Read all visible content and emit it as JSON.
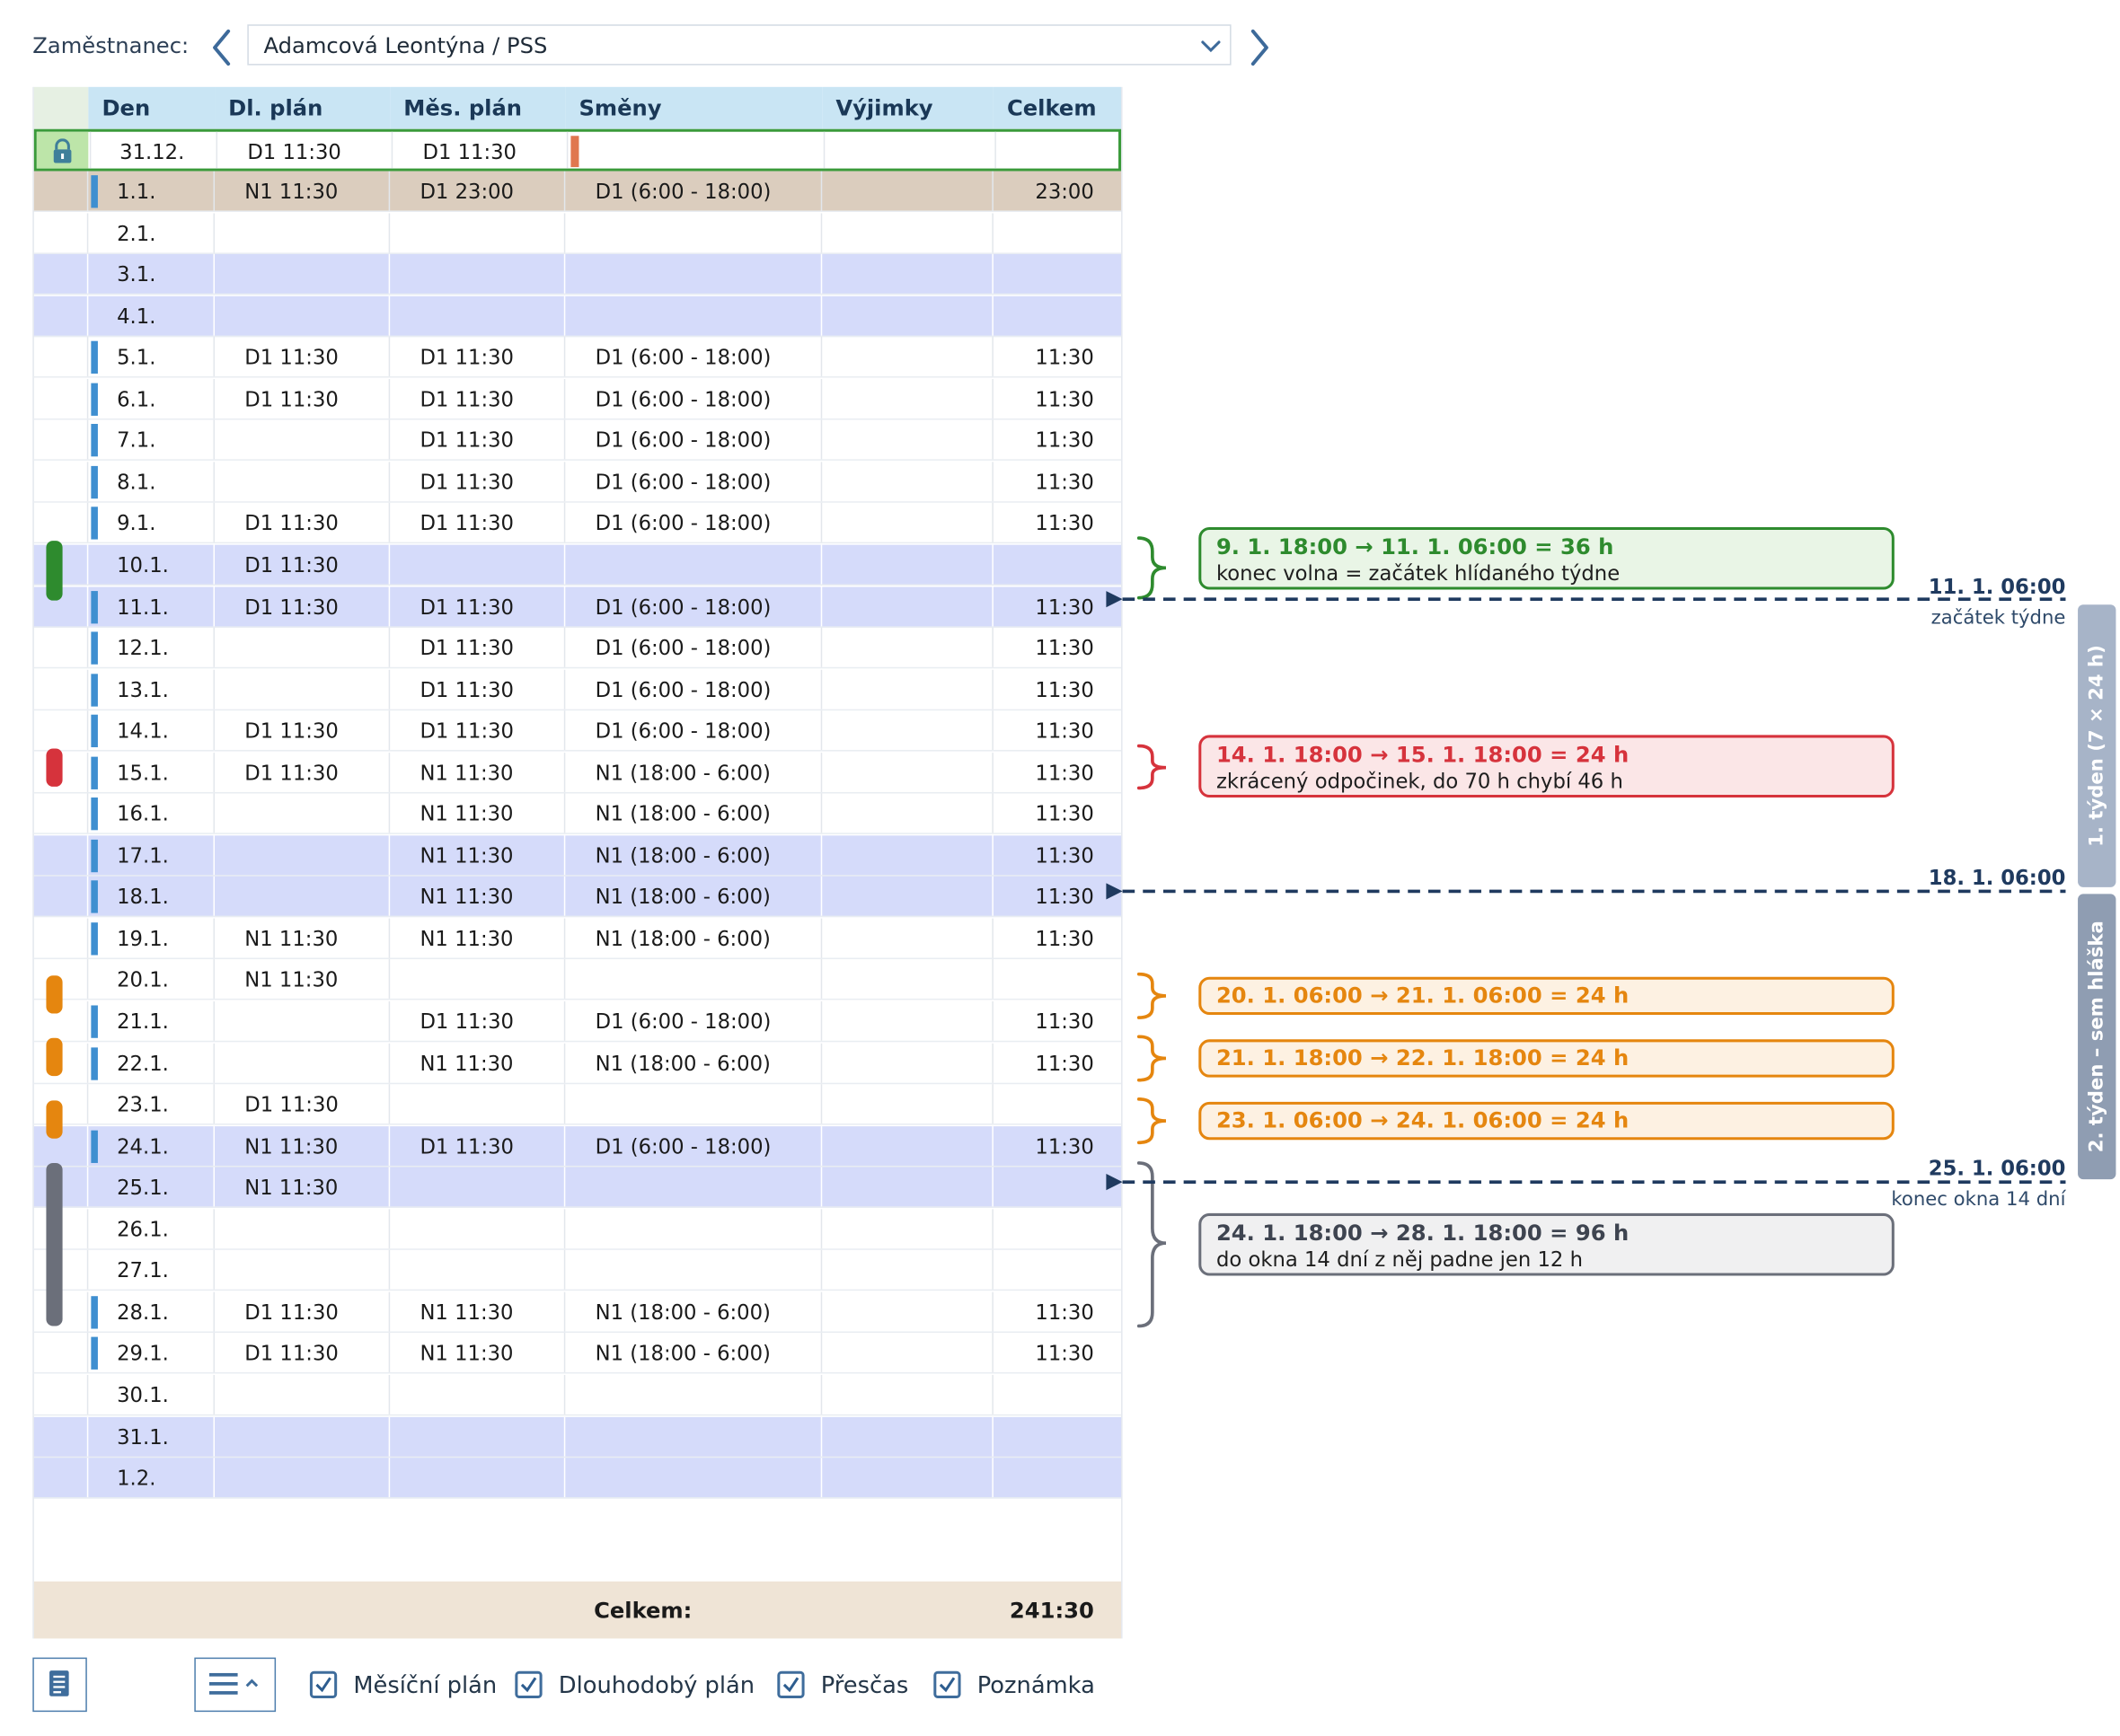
{
  "employee": {
    "label": "Zaměstnanec:",
    "value": "Adamcová Leontýna / PSS"
  },
  "columns": [
    "",
    "Den",
    "Dl. plán",
    "Měs. plán",
    "Směny",
    "Výjimky",
    "Celkem"
  ],
  "rows": [
    {
      "day": "31.12.",
      "dl": "D1 11:30",
      "mes": "D1 11:30",
      "smeny": "",
      "vyjimky": "",
      "celkem": "",
      "locked": true
    },
    {
      "day": "1.1.",
      "dl": "N1 11:30",
      "mes": "D1 23:00",
      "smeny": "D1 (6:00 - 18:00)",
      "vyjimky": "",
      "celkem": "23:00",
      "selected": true,
      "bar": true
    },
    {
      "day": "2.1.",
      "dl": "",
      "mes": "",
      "smeny": "",
      "vyjimky": "",
      "celkem": ""
    },
    {
      "day": "3.1.",
      "dl": "",
      "mes": "",
      "smeny": "",
      "vyjimky": "",
      "celkem": "",
      "weekend": true
    },
    {
      "day": "4.1.",
      "dl": "",
      "mes": "",
      "smeny": "",
      "vyjimky": "",
      "celkem": "",
      "weekend": true
    },
    {
      "day": "5.1.",
      "dl": "D1 11:30",
      "mes": "D1 11:30",
      "smeny": "D1 (6:00 - 18:00)",
      "vyjimky": "",
      "celkem": "11:30",
      "bar": true
    },
    {
      "day": "6.1.",
      "dl": "D1 11:30",
      "mes": "D1 11:30",
      "smeny": "D1 (6:00 - 18:00)",
      "vyjimky": "",
      "celkem": "11:30",
      "bar": true
    },
    {
      "day": "7.1.",
      "dl": "",
      "mes": "D1 11:30",
      "smeny": "D1 (6:00 - 18:00)",
      "vyjimky": "",
      "celkem": "11:30",
      "bar": true
    },
    {
      "day": "8.1.",
      "dl": "",
      "mes": "D1 11:30",
      "smeny": "D1 (6:00 - 18:00)",
      "vyjimky": "",
      "celkem": "11:30",
      "bar": true
    },
    {
      "day": "9.1.",
      "dl": "D1 11:30",
      "mes": "D1 11:30",
      "smeny": "D1 (6:00 - 18:00)",
      "vyjimky": "",
      "celkem": "11:30",
      "bar": true
    },
    {
      "day": "10.1.",
      "dl": "D1 11:30",
      "mes": "",
      "smeny": "",
      "vyjimky": "",
      "celkem": "",
      "weekend": true
    },
    {
      "day": "11.1.",
      "dl": "D1 11:30",
      "mes": "D1 11:30",
      "smeny": "D1 (6:00 - 18:00)",
      "vyjimky": "",
      "celkem": "11:30",
      "weekend": true,
      "bar": true
    },
    {
      "day": "12.1.",
      "dl": "",
      "mes": "D1 11:30",
      "smeny": "D1 (6:00 - 18:00)",
      "vyjimky": "",
      "celkem": "11:30",
      "bar": true
    },
    {
      "day": "13.1.",
      "dl": "",
      "mes": "D1 11:30",
      "smeny": "D1 (6:00 - 18:00)",
      "vyjimky": "",
      "celkem": "11:30",
      "bar": true
    },
    {
      "day": "14.1.",
      "dl": "D1 11:30",
      "mes": "D1 11:30",
      "smeny": "D1 (6:00 - 18:00)",
      "vyjimky": "",
      "celkem": "11:30",
      "bar": true
    },
    {
      "day": "15.1.",
      "dl": "D1 11:30",
      "mes": "N1 11:30",
      "smeny": "N1 (18:00 - 6:00)",
      "vyjimky": "",
      "celkem": "11:30",
      "bar": true
    },
    {
      "day": "16.1.",
      "dl": "",
      "mes": "N1 11:30",
      "smeny": "N1 (18:00 - 6:00)",
      "vyjimky": "",
      "celkem": "11:30",
      "bar": true
    },
    {
      "day": "17.1.",
      "dl": "",
      "mes": "N1 11:30",
      "smeny": "N1 (18:00 - 6:00)",
      "vyjimky": "",
      "celkem": "11:30",
      "weekend": true,
      "bar": true
    },
    {
      "day": "18.1.",
      "dl": "",
      "mes": "N1 11:30",
      "smeny": "N1 (18:00 - 6:00)",
      "vyjimky": "",
      "celkem": "11:30",
      "weekend": true,
      "bar": true
    },
    {
      "day": "19.1.",
      "dl": "N1 11:30",
      "mes": "N1 11:30",
      "smeny": "N1 (18:00 - 6:00)",
      "vyjimky": "",
      "celkem": "11:30",
      "bar": true
    },
    {
      "day": "20.1.",
      "dl": "N1 11:30",
      "mes": "",
      "smeny": "",
      "vyjimky": "",
      "celkem": ""
    },
    {
      "day": "21.1.",
      "dl": "",
      "mes": "D1 11:30",
      "smeny": "D1 (6:00 - 18:00)",
      "vyjimky": "",
      "celkem": "11:30",
      "bar": true
    },
    {
      "day": "22.1.",
      "dl": "",
      "mes": "N1 11:30",
      "smeny": "N1 (18:00 - 6:00)",
      "vyjimky": "",
      "celkem": "11:30",
      "bar": true
    },
    {
      "day": "23.1.",
      "dl": "D1 11:30",
      "mes": "",
      "smeny": "",
      "vyjimky": "",
      "celkem": ""
    },
    {
      "day": "24.1.",
      "dl": "N1 11:30",
      "mes": "D1 11:30",
      "smeny": "D1 (6:00 - 18:00)",
      "vyjimky": "",
      "celkem": "11:30",
      "weekend": true,
      "bar": true
    },
    {
      "day": "25.1.",
      "dl": "N1 11:30",
      "mes": "",
      "smeny": "",
      "vyjimky": "",
      "celkem": "",
      "weekend": true
    },
    {
      "day": "26.1.",
      "dl": "",
      "mes": "",
      "smeny": "",
      "vyjimky": "",
      "celkem": ""
    },
    {
      "day": "27.1.",
      "dl": "",
      "mes": "",
      "smeny": "",
      "vyjimky": "",
      "celkem": ""
    },
    {
      "day": "28.1.",
      "dl": "D1 11:30",
      "mes": "N1 11:30",
      "smeny": "N1 (18:00 - 6:00)",
      "vyjimky": "",
      "celkem": "11:30",
      "bar": true
    },
    {
      "day": "29.1.",
      "dl": "D1 11:30",
      "mes": "N1 11:30",
      "smeny": "N1 (18:00 - 6:00)",
      "vyjimky": "",
      "celkem": "11:30",
      "bar": true
    },
    {
      "day": "30.1.",
      "dl": "",
      "mes": "",
      "smeny": "",
      "vyjimky": "",
      "celkem": ""
    },
    {
      "day": "31.1.",
      "dl": "",
      "mes": "",
      "smeny": "",
      "vyjimky": "",
      "celkem": "",
      "weekend": true
    },
    {
      "day": "1.2.",
      "dl": "",
      "mes": "",
      "smeny": "",
      "vyjimky": "",
      "celkem": "",
      "weekend": true
    }
  ],
  "total": {
    "label": "Celkem:",
    "value": "241:30"
  },
  "toolbar": {
    "checkboxes": [
      {
        "label": "Měsíční plán",
        "checked": true
      },
      {
        "label": "Dlouhodobý plán",
        "checked": true
      },
      {
        "label": "Přesčas",
        "checked": true
      },
      {
        "label": "Poznámka",
        "checked": true
      }
    ]
  },
  "annotations": {
    "callouts": [
      {
        "title": "9. 1. 18:00 → 11. 1. 06:00 = 36 h",
        "text": "konec volna = začátek hlídaného týdne",
        "color": "#2e8b2e",
        "bg": "#e9f5e6"
      },
      {
        "title": "14. 1. 18:00 → 15. 1. 18:00 = 24 h",
        "text": "zkrácený odpočinek, do 70 h chybí 46 h",
        "color": "#d6333c",
        "bg": "#fbe6e7"
      },
      {
        "title": "20. 1. 06:00 → 21. 1. 06:00 = 24 h",
        "text": "",
        "color": "#e5860f",
        "bg": "#fdf1e2"
      },
      {
        "title": "21. 1. 18:00 → 22. 1. 18:00 = 24 h",
        "text": "",
        "color": "#e5860f",
        "bg": "#fdf1e2"
      },
      {
        "title": "23. 1. 06:00 → 24. 1. 06:00 = 24 h",
        "text": "",
        "color": "#e5860f",
        "bg": "#fdf1e2"
      },
      {
        "title": "24. 1. 18:00 → 28. 1. 18:00 = 96 h",
        "text": "do okna 14 dní z něj padne jen 12 h",
        "color": "#6b6f7a",
        "bg": "#f0f0f1"
      }
    ],
    "markers": [
      {
        "label": "11. 1. 06:00",
        "sub": "začátek týdne"
      },
      {
        "label": "18. 1. 06:00",
        "sub": ""
      },
      {
        "label": "25. 1. 06:00",
        "sub": "konec okna 14 dní"
      }
    ],
    "week_tabs": [
      "1. týden (7 × 24 h)",
      "2. týden – sem hláška"
    ]
  },
  "colors": {
    "line": "#1f3a5f",
    "blue_bar": "#3f8fd0",
    "weekend": "#d5dbfa",
    "selected": "#dbcdbe"
  }
}
